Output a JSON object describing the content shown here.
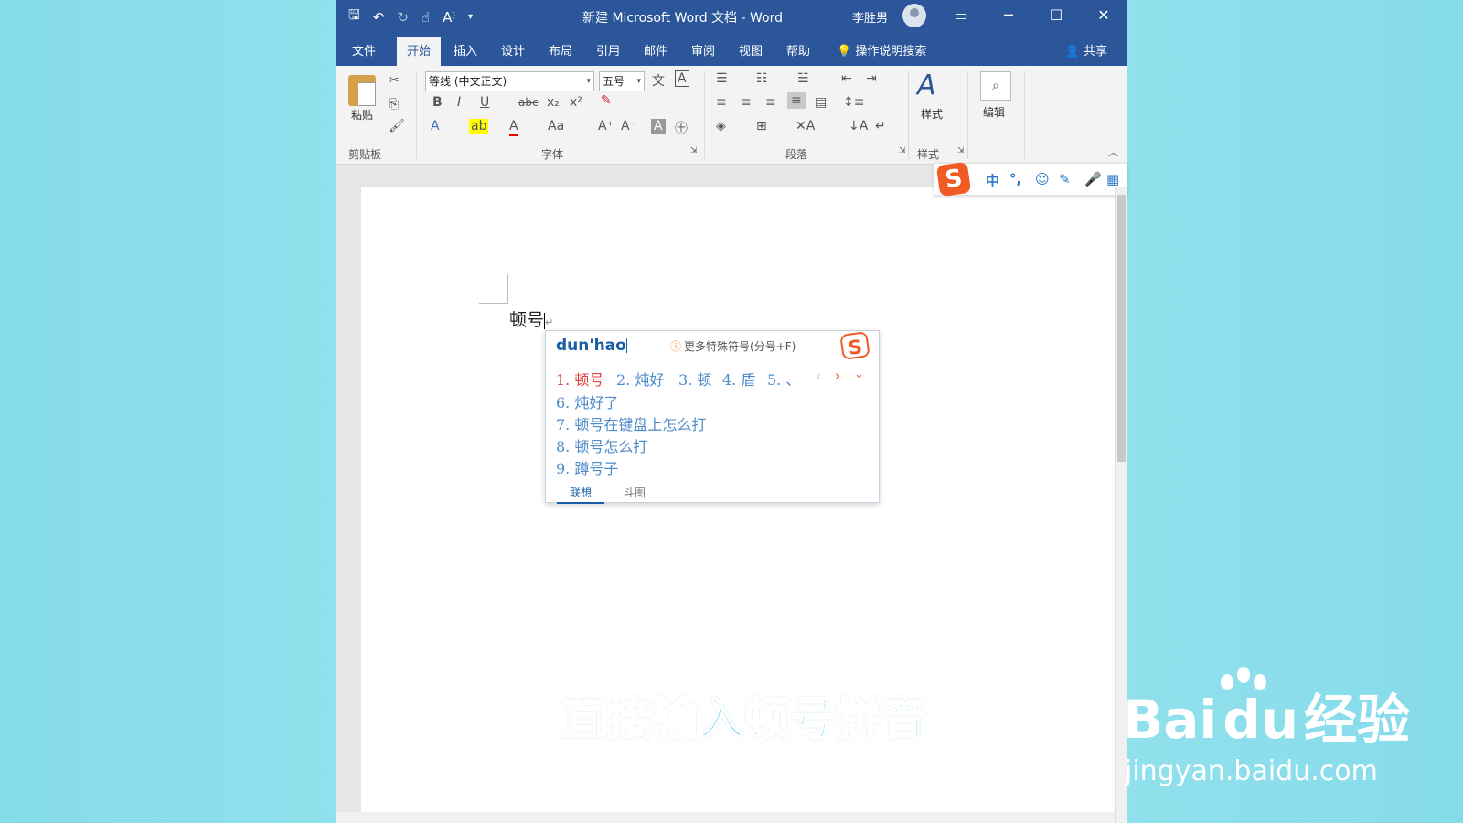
{
  "window": {
    "title": "新建 Microsoft Word 文档 - Word",
    "user": "李胜男",
    "controls": [
      "▭",
      "─",
      "☐",
      "✕"
    ]
  },
  "tabs": [
    "文件",
    "开始",
    "插入",
    "设计",
    "布局",
    "引用",
    "邮件",
    "审阅",
    "视图",
    "帮助"
  ],
  "active_tab": "开始",
  "tell_me": "操作说明搜索",
  "share": "共享",
  "ribbon": {
    "paste": "粘贴",
    "clipboard": "剪贴板",
    "font_name": "等线 (中文正文)",
    "font_size": "五号",
    "font_group": "字体",
    "paragraph_group": "段落",
    "styles": "样式",
    "styles_group": "样式",
    "editing": "编辑"
  },
  "sogou_toolbar": {
    "mode": "中"
  },
  "document": {
    "text": "顿号"
  },
  "ime": {
    "pinyin": "dun'hao",
    "hint": "更多特殊符号(分号+F)",
    "candidates_row": [
      "1. 顿号",
      "2. 炖好",
      "3. 顿",
      "4. 盾",
      "5. 、"
    ],
    "candidates_list": [
      "6. 炖好了",
      "7. 顿号在键盘上怎么打",
      "8. 顿号怎么打",
      "9. 蹲号子"
    ],
    "footer_tabs": [
      "联想",
      "斗图"
    ]
  },
  "caption": "直接输入顿号拼音",
  "watermark": {
    "brand": "Bai",
    "brand2": "du",
    "cn": "经验",
    "url": "jingyan.baidu.com"
  },
  "colors": {
    "word_blue": "#2b579a",
    "sogou_orange": "#f05a24",
    "candidate_first": "#e0433e",
    "candidate": "#4d8bc9"
  }
}
